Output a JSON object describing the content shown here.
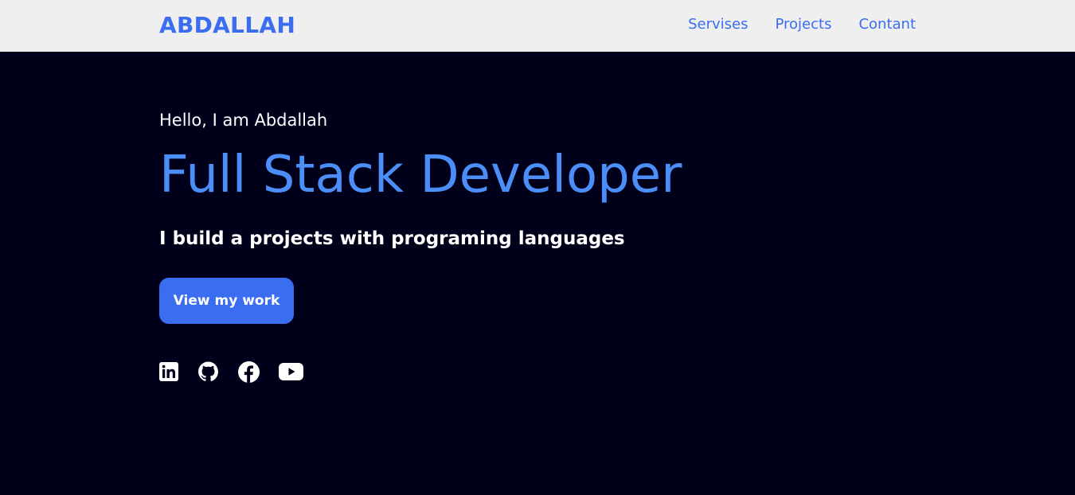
{
  "navbar": {
    "brand": "ABDALLAH",
    "links": [
      {
        "label": "Servises"
      },
      {
        "label": "Projects"
      },
      {
        "label": "Contant"
      }
    ]
  },
  "hero": {
    "greeting": "Hello, I am Abdallah",
    "headline": "Full Stack Developer",
    "subheadline": "I build a projects with programing languages",
    "cta_label": "View my work"
  },
  "socials": [
    {
      "icon": "linkedin-icon"
    },
    {
      "icon": "github-icon"
    },
    {
      "icon": "facebook-icon"
    },
    {
      "icon": "youtube-icon"
    }
  ],
  "colors": {
    "accent": "#3a6df0",
    "headline": "#4c8ef7",
    "background": "#00001a",
    "navbar": "#efefef"
  }
}
